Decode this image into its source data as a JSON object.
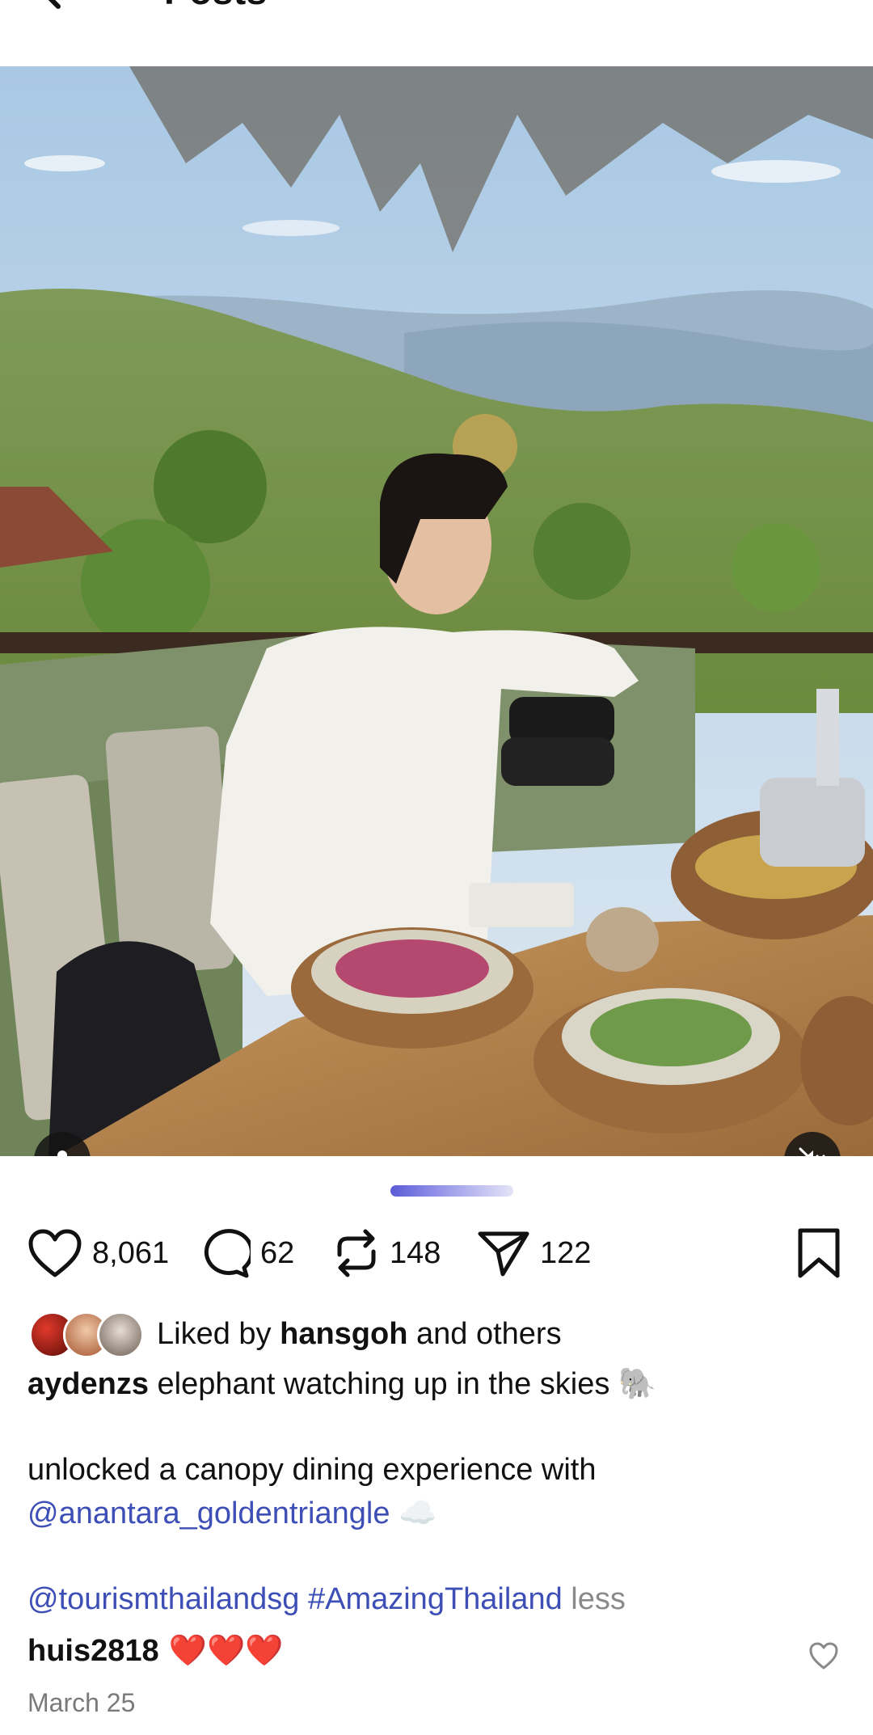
{
  "header": {
    "title": "Posts",
    "back_icon": "arrow-left-icon"
  },
  "post": {
    "photo_alt": "",
    "tag_icon": "person-icon",
    "mute_icon": "speaker-muted-icon"
  },
  "actions": {
    "likes": "8,061",
    "comments": "62",
    "reposts": "148",
    "shares": "122"
  },
  "liked_by": {
    "prefix": "Liked by",
    "user": "hansgoh",
    "suffix": "and others"
  },
  "caption": {
    "user": "aydenzs",
    "line1": "elephant watching up in the skies 🐘",
    "line2": "unlocked a canopy dining experience with",
    "mention1": "@anantara_goldentriangle",
    "cloud": "☁️",
    "mention2": "@tourismthailandsg",
    "hashtag": "#AmazingThailand",
    "less": "less"
  },
  "comment": {
    "user": "huis2818",
    "text": "❤️❤️❤️"
  },
  "date": "March 25",
  "colors": {
    "link": "#3d4fb6",
    "indicator": "#5b5bd6",
    "muted_text": "#7a7a7a"
  }
}
